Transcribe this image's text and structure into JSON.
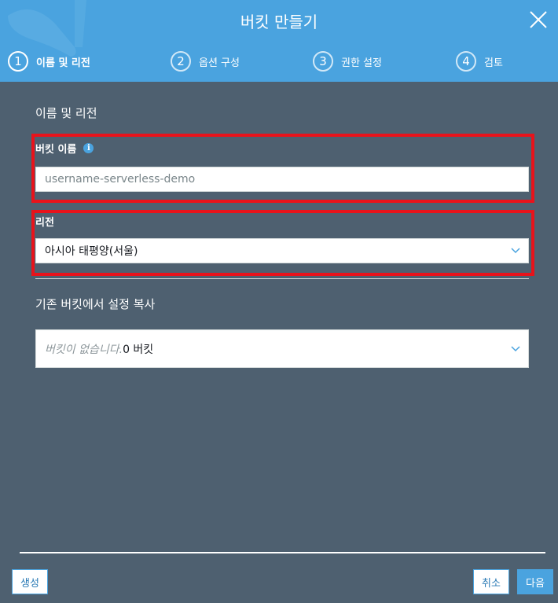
{
  "dialog": {
    "title": "버킷 만들기",
    "close_icon": "close-icon"
  },
  "steps": [
    {
      "number": "1",
      "label": "이름 및 리전",
      "active": true
    },
    {
      "number": "2",
      "label": "옵션 구성",
      "active": false
    },
    {
      "number": "3",
      "label": "권한 설정",
      "active": false
    },
    {
      "number": "4",
      "label": "검토",
      "active": false
    }
  ],
  "section": {
    "title": "이름 및 리전"
  },
  "bucket_name": {
    "label": "버킷 이름",
    "info_icon": "info-icon",
    "value": "username-serverless-demo"
  },
  "region": {
    "label": "리전",
    "selected": "아시아 태평양(서울)"
  },
  "copy_settings": {
    "title": "기존 버킷에서 설정 복사",
    "placeholder": "버킷이 없습니다.",
    "count": "0 버킷"
  },
  "footer": {
    "create_label": "생성",
    "cancel_label": "취소",
    "next_label": "다음"
  },
  "colors": {
    "header": "#4aa3df",
    "body": "#4e6070",
    "highlight": "#e8131b"
  }
}
